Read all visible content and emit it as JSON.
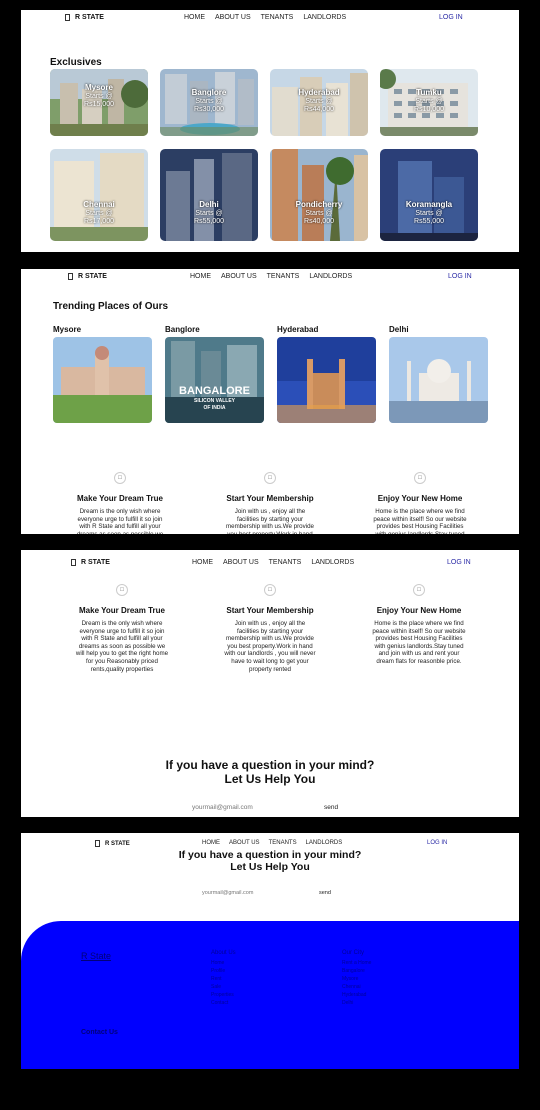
{
  "nav": {
    "brand": "R STATE",
    "links": [
      "HOME",
      "ABOUT US",
      "TENANTS",
      "LANDLORDS"
    ],
    "login": "LOG IN"
  },
  "exclusives": {
    "title": "Exclusives",
    "cards": [
      {
        "city": "Mysore",
        "starts": "Starts @",
        "price": "Rs15,000"
      },
      {
        "city": "Banglore",
        "starts": "Starts @",
        "price": "Rs30,000"
      },
      {
        "city": "Hyderabad",
        "starts": "Starts @",
        "price": "Rs44,000"
      },
      {
        "city": "Tumku",
        "starts": "Starts @",
        "price": "Rs10,000"
      },
      {
        "city": "Chennai",
        "starts": "Starts @",
        "price": "Rs17,000"
      },
      {
        "city": "Delhi",
        "starts": "Starts @",
        "price": "Rs55,000"
      },
      {
        "city": "Pondicherry",
        "starts": "Starts @",
        "price": "Rs40,000"
      },
      {
        "city": "Koramangla",
        "starts": "Starts @",
        "price": "Rs55,000"
      }
    ]
  },
  "trending": {
    "title": "Trending Places of Ours",
    "places": [
      {
        "name": "Mysore"
      },
      {
        "name": "Banglore",
        "overlay_title": "BANGALORE",
        "overlay_sub1": "SILICON VALLEY",
        "overlay_sub2": "OF INDIA"
      },
      {
        "name": "Hyderabad"
      },
      {
        "name": "Delhi"
      }
    ]
  },
  "features": [
    {
      "title": "Make Your Dream True",
      "lines": [
        "Dream is the only wish where",
        "everyone urge to fulfill it so join",
        "with R State and fulfill all your",
        "dreams as soon as possible we",
        "will help you to get the right home",
        "for you Reasonably priced",
        "rents,quality properties"
      ]
    },
    {
      "title": "Start Your Membership",
      "lines": [
        "Join with us , enjoy all the",
        "facilities by starting your",
        "membership with us.We provide",
        "you best property.Work in hand",
        "with our landlords , you will never",
        "have to wait long to get your",
        "property rented"
      ]
    },
    {
      "title": "Enjoy Your New Home",
      "lines": [
        "Home is the place where we find",
        "peace within itself! So our website",
        "provides best Housing Facilities",
        "with genius landlords.Stay tuned",
        "and join with us and rent your",
        "dream flats for reasonble price."
      ]
    }
  ],
  "help": {
    "line1": "If you have a question in your mind?",
    "line2": "Let Us Help You",
    "email_placeholder": "yourmail@gmail.com",
    "send": "send"
  },
  "footer": {
    "brand": "R State",
    "contact": "Contact Us",
    "col1": {
      "heading": "About Us",
      "items": [
        "Home",
        "Profile",
        "Rent",
        "Sale",
        "Properties",
        "Contact"
      ]
    },
    "col2": {
      "heading": "Our City",
      "items": [
        "Rent a Home",
        "Bangalore",
        "Mysore",
        "Chennai",
        "Hyderabad",
        "Delhi"
      ]
    }
  },
  "colors": {
    "footer_bg": "#0000ff",
    "login": "#2a2aa6"
  }
}
